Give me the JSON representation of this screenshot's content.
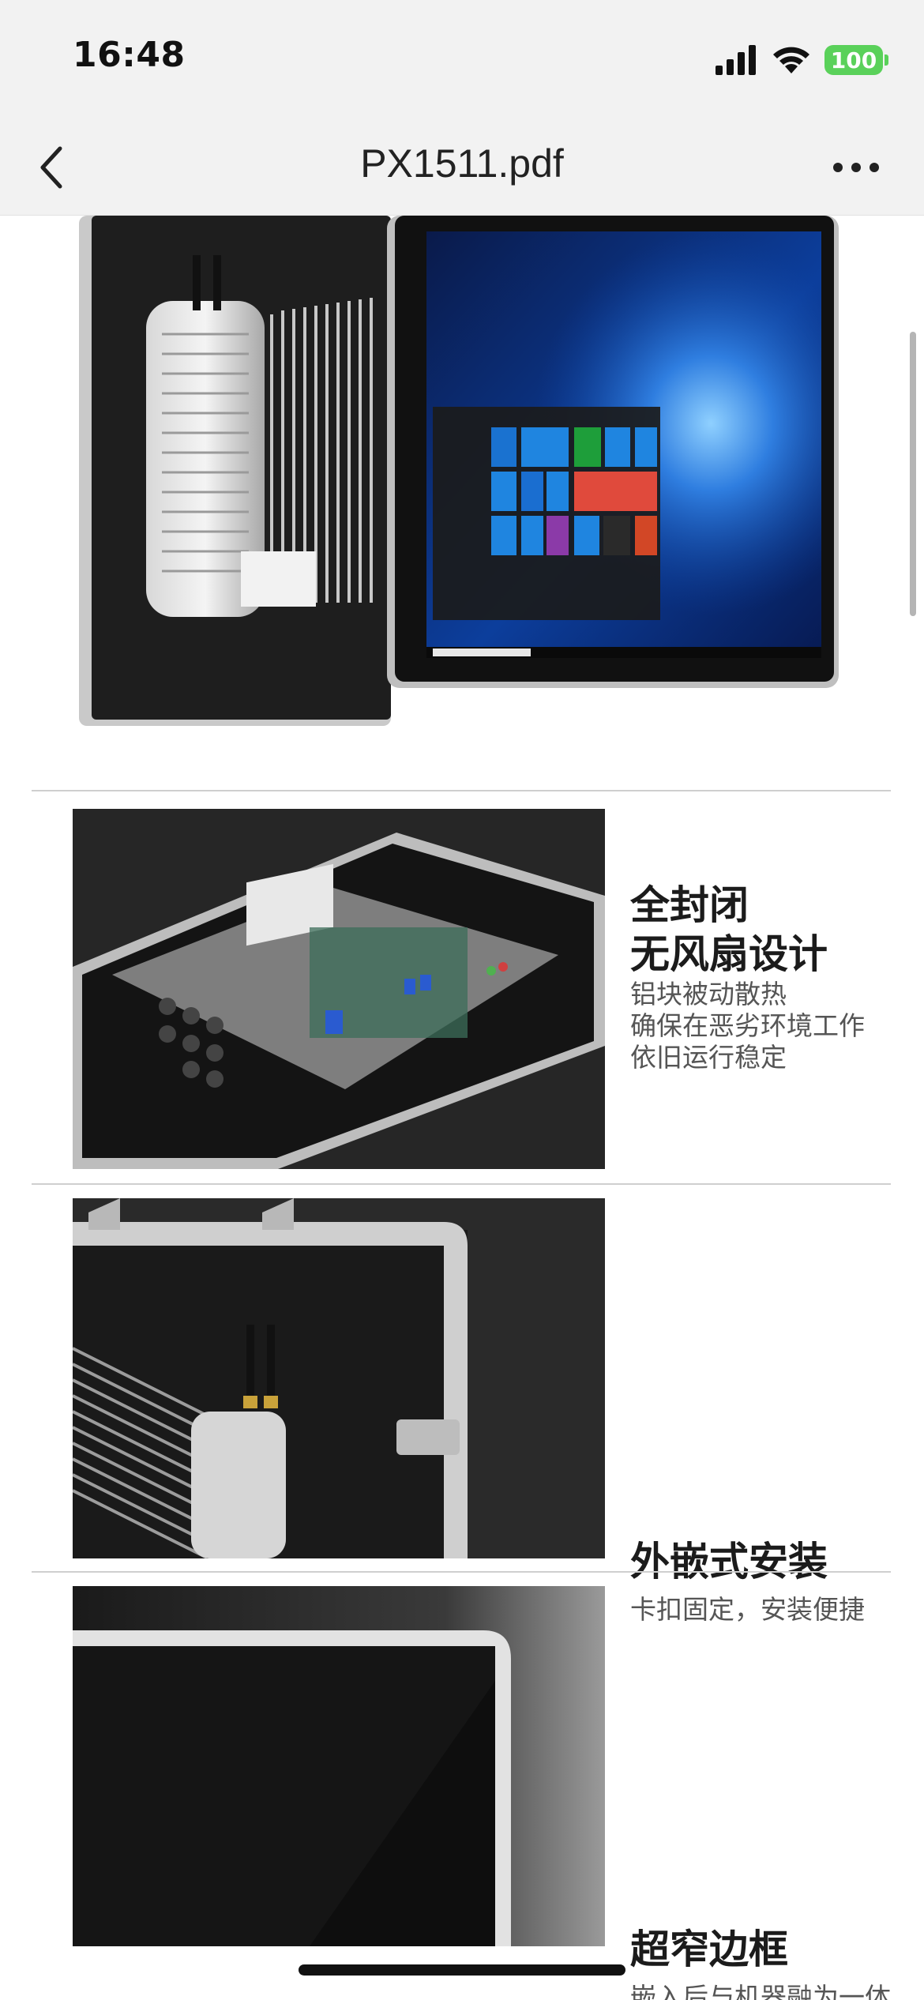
{
  "status": {
    "time": "16:48",
    "battery": "100",
    "icons": [
      "cellular-signal-icon",
      "wifi-icon",
      "battery-icon"
    ]
  },
  "nav": {
    "title": "PX1511.pdf",
    "back_icon": "chevron-left-icon",
    "more_icon": "ellipsis-icon"
  },
  "features": [
    {
      "title_lines": [
        "全封闭",
        "无风扇设计"
      ],
      "sub_lines": [
        "铝块被动散热",
        "确保在恶劣环境工作",
        "依旧运行稳定"
      ]
    },
    {
      "title_lines": [
        "外嵌式安装"
      ],
      "sub_lines": [
        "卡扣固定，安装便捷"
      ]
    },
    {
      "title_lines": [
        "超窄边框"
      ],
      "sub_lines": [
        "嵌入后与机器融为一体"
      ]
    }
  ],
  "colors": {
    "battery": "#5ad15a",
    "chrome_bg": "#f2f2f2",
    "divider": "#cfcfcf"
  }
}
